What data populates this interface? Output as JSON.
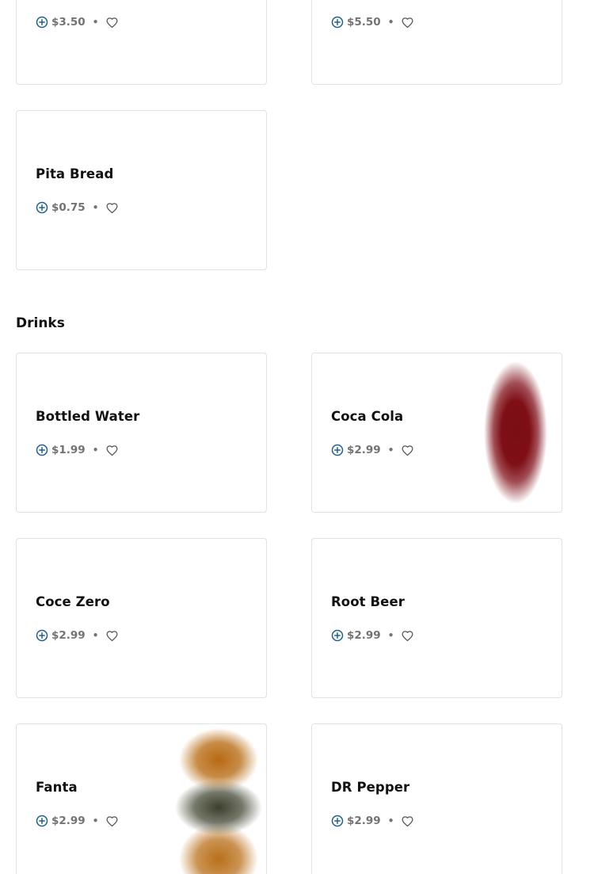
{
  "colors": {
    "accent": "#1f5f8b",
    "price_text": "#737373",
    "card_border": "#e2e2e2"
  },
  "icons": {
    "add": "plus-circle-icon",
    "favorite": "heart-outline-icon"
  },
  "top_items": [
    {
      "name": "",
      "price": "$3.50"
    },
    {
      "name": "",
      "price": "$5.50"
    },
    {
      "name": "Pita Bread",
      "price": "$0.75"
    }
  ],
  "drinks": {
    "title": "Drinks",
    "items": [
      {
        "name": "Bottled Water",
        "price": "$1.99"
      },
      {
        "name": "Coca Cola",
        "price": "$2.99"
      },
      {
        "name": "Coce Zero",
        "price": "$2.99"
      },
      {
        "name": "Root Beer",
        "price": "$2.99"
      },
      {
        "name": "Fanta",
        "price": "$2.99"
      },
      {
        "name": "DR Pepper",
        "price": "$2.99"
      }
    ]
  },
  "separator": "•"
}
